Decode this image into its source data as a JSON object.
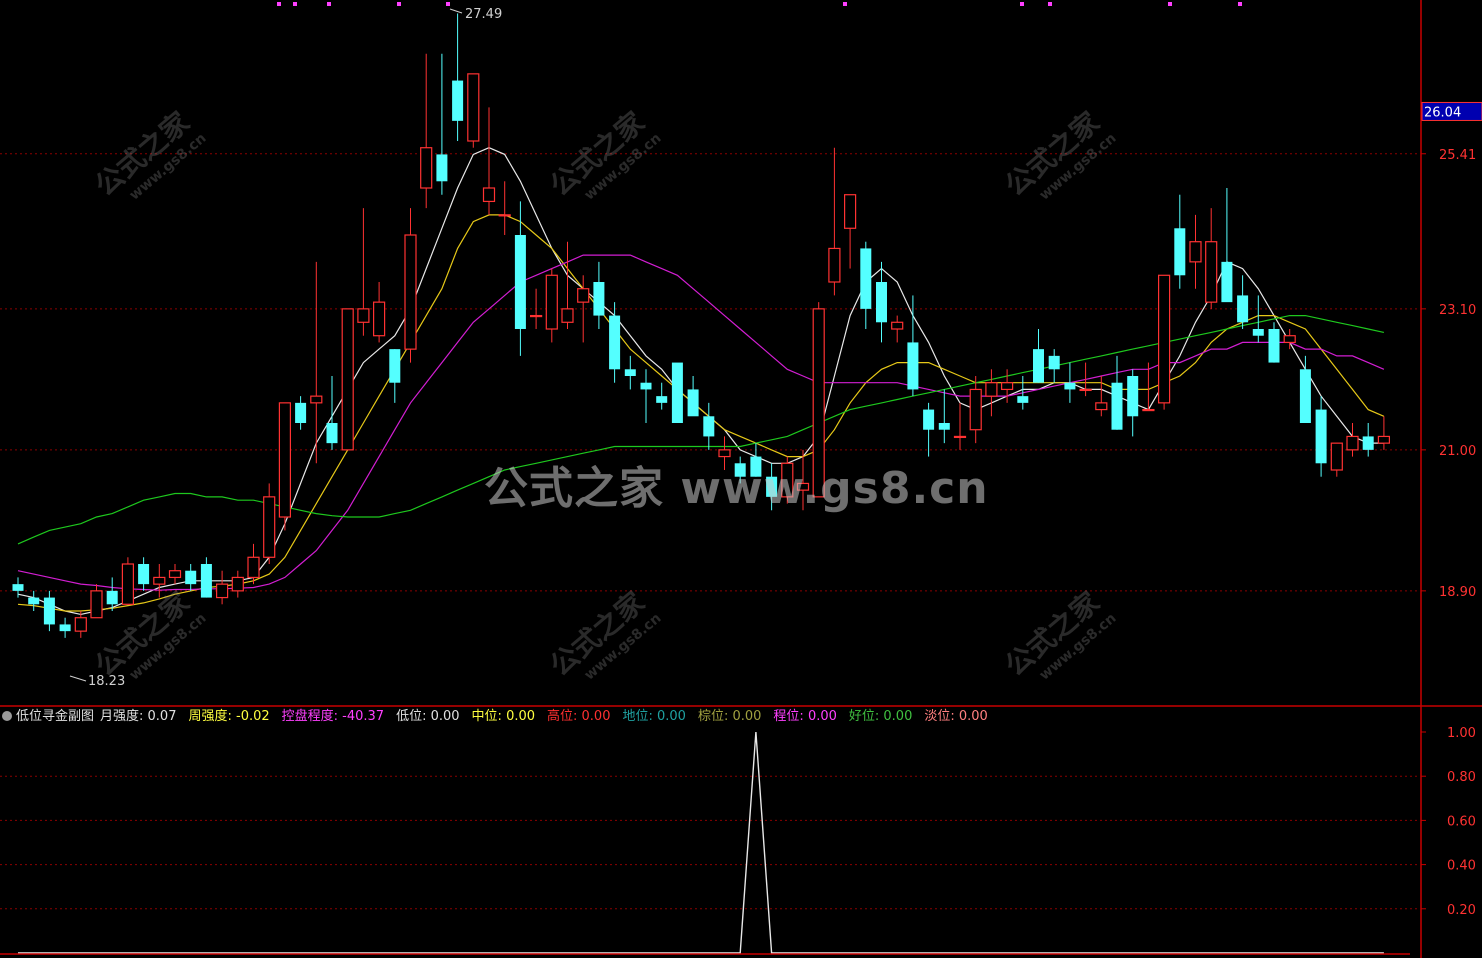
{
  "watermark": {
    "center": "公式之家 www.gs8.cn",
    "tile_main": "公式之家",
    "tile_sub": "www.gs8.cn"
  },
  "price_axis": {
    "labels": [
      "26.04",
      "25.41",
      "23.10",
      "21.00",
      "18.90"
    ],
    "current": "26.04"
  },
  "indicator_axis": {
    "labels": [
      "1.00",
      "0.80",
      "0.60",
      "0.40",
      "0.20"
    ]
  },
  "annotations": {
    "high": "27.49",
    "low": "18.23"
  },
  "indicator_header": {
    "name": "低位寻金副图",
    "items": [
      {
        "label": "月强度",
        "value": "0.07",
        "color": "#e0e0e0"
      },
      {
        "label": "周强度",
        "value": "-0.02",
        "color": "#ffff40"
      },
      {
        "label": "控盘程度",
        "value": "-40.37",
        "color": "#ff40ff"
      },
      {
        "label": "低位",
        "value": "0.00",
        "color": "#e0e0e0"
      },
      {
        "label": "中位",
        "value": "0.00",
        "color": "#ffff40"
      },
      {
        "label": "高位",
        "value": "0.00",
        "color": "#ff3030"
      },
      {
        "label": "地位",
        "value": "0.00",
        "color": "#1fa0a0"
      },
      {
        "label": "棕位",
        "value": "0.00",
        "color": "#a0a040"
      },
      {
        "label": "程位",
        "value": "0.00",
        "color": "#ff40ff"
      },
      {
        "label": "好位",
        "value": "0.00",
        "color": "#40c040"
      },
      {
        "label": "淡位",
        "value": "0.00",
        "color": "#ff8080"
      }
    ]
  },
  "colors": {
    "up": "#ff3232",
    "down": "#54ffff",
    "ma1": "#e8e8e8",
    "ma2": "#e6c818",
    "ma3": "#d21ed2",
    "ma4": "#1ec81e",
    "grid": "#8b0000",
    "axis": "#c80000"
  },
  "chart_data": [
    {
      "type": "candlestick",
      "ylim": [
        17.2,
        27.7
      ],
      "grid_levels": [
        25.41,
        23.1,
        21.0,
        18.9
      ],
      "ohlc": [
        [
          19.0,
          19.1,
          18.8,
          18.9
        ],
        [
          18.8,
          18.9,
          18.6,
          18.7
        ],
        [
          18.8,
          18.9,
          18.3,
          18.4
        ],
        [
          18.4,
          18.5,
          18.2,
          18.3
        ],
        [
          18.3,
          18.6,
          18.2,
          18.5
        ],
        [
          18.5,
          19.0,
          18.5,
          18.9
        ],
        [
          18.9,
          19.1,
          18.6,
          18.7
        ],
        [
          18.7,
          19.4,
          18.7,
          19.3
        ],
        [
          19.3,
          19.4,
          18.9,
          19.0
        ],
        [
          19.0,
          19.3,
          18.8,
          19.1
        ],
        [
          19.1,
          19.3,
          19.0,
          19.2
        ],
        [
          19.2,
          19.3,
          18.9,
          19.0
        ],
        [
          19.3,
          19.4,
          18.8,
          18.8
        ],
        [
          18.8,
          19.2,
          18.7,
          19.0
        ],
        [
          18.9,
          19.2,
          18.8,
          19.1
        ],
        [
          19.1,
          19.6,
          19.0,
          19.4
        ],
        [
          19.4,
          20.5,
          19.3,
          20.3
        ],
        [
          20.0,
          21.7,
          19.8,
          21.7
        ],
        [
          21.7,
          21.8,
          21.3,
          21.4
        ],
        [
          21.7,
          23.8,
          20.8,
          21.8
        ],
        [
          21.4,
          22.1,
          21.0,
          21.1
        ],
        [
          21.0,
          23.1,
          21.0,
          23.1
        ],
        [
          22.9,
          24.6,
          22.7,
          23.1
        ],
        [
          22.7,
          23.5,
          22.6,
          23.2
        ],
        [
          22.5,
          22.5,
          21.7,
          22.0
        ],
        [
          22.5,
          24.6,
          22.3,
          24.2
        ],
        [
          24.9,
          26.9,
          24.6,
          25.5
        ],
        [
          25.4,
          26.9,
          24.8,
          25.0
        ],
        [
          26.5,
          27.5,
          25.6,
          25.9
        ],
        [
          25.6,
          26.6,
          25.5,
          26.6
        ],
        [
          24.7,
          26.1,
          24.5,
          24.9
        ],
        [
          24.5,
          25.0,
          24.2,
          24.5
        ],
        [
          24.2,
          24.7,
          22.4,
          22.8
        ],
        [
          23.0,
          23.4,
          22.8,
          23.0
        ],
        [
          22.8,
          23.7,
          22.6,
          23.6
        ],
        [
          22.9,
          24.1,
          22.8,
          23.1
        ],
        [
          23.2,
          23.6,
          22.6,
          23.4
        ],
        [
          23.5,
          23.8,
          22.8,
          23.0
        ],
        [
          23.0,
          23.2,
          22.0,
          22.2
        ],
        [
          22.2,
          22.4,
          21.9,
          22.1
        ],
        [
          22.0,
          22.2,
          21.4,
          21.9
        ],
        [
          21.8,
          22.0,
          21.6,
          21.7
        ],
        [
          22.3,
          22.0,
          21.7,
          21.4
        ],
        [
          21.9,
          22.1,
          21.7,
          21.5
        ],
        [
          21.5,
          21.7,
          21.0,
          21.2
        ],
        [
          20.9,
          21.2,
          20.7,
          21.0
        ],
        [
          20.8,
          20.9,
          20.5,
          20.6
        ],
        [
          20.9,
          21.1,
          20.6,
          20.6
        ],
        [
          20.6,
          20.8,
          20.1,
          20.3
        ],
        [
          20.3,
          20.9,
          20.2,
          20.8
        ],
        [
          20.4,
          21.0,
          20.1,
          20.5
        ],
        [
          20.3,
          23.2,
          20.3,
          23.1
        ],
        [
          23.5,
          25.5,
          23.3,
          24.0
        ],
        [
          24.3,
          24.8,
          23.7,
          24.8
        ],
        [
          24.0,
          24.1,
          22.8,
          23.1
        ],
        [
          23.5,
          23.8,
          22.6,
          22.9
        ],
        [
          22.8,
          23.0,
          22.6,
          22.9
        ],
        [
          22.6,
          23.3,
          21.8,
          21.9
        ],
        [
          21.6,
          21.7,
          20.9,
          21.3
        ],
        [
          21.4,
          21.9,
          21.1,
          21.3
        ],
        [
          21.2,
          21.7,
          21.0,
          21.2
        ],
        [
          21.3,
          22.1,
          21.1,
          21.9
        ],
        [
          21.8,
          22.2,
          21.5,
          22.0
        ],
        [
          21.9,
          22.2,
          21.7,
          22.0
        ],
        [
          21.8,
          22.1,
          21.6,
          21.7
        ],
        [
          22.5,
          22.8,
          22.0,
          22.0
        ],
        [
          22.4,
          22.5,
          22.0,
          22.2
        ],
        [
          22.0,
          22.3,
          21.7,
          21.9
        ],
        [
          21.9,
          22.3,
          21.8,
          21.9
        ],
        [
          21.6,
          22.1,
          21.5,
          21.7
        ],
        [
          22.0,
          22.4,
          21.3,
          21.3
        ],
        [
          22.1,
          22.2,
          21.2,
          21.5
        ],
        [
          21.6,
          22.3,
          21.6,
          21.6
        ],
        [
          21.7,
          23.6,
          21.6,
          23.6
        ],
        [
          24.3,
          24.8,
          23.4,
          23.6
        ],
        [
          23.8,
          24.5,
          23.4,
          24.1
        ],
        [
          23.2,
          24.6,
          23.1,
          24.1
        ],
        [
          23.8,
          24.9,
          23.3,
          23.2
        ],
        [
          23.3,
          23.6,
          22.8,
          22.9
        ],
        [
          22.8,
          23.3,
          22.6,
          22.7
        ],
        [
          22.8,
          22.9,
          22.3,
          22.3
        ],
        [
          22.6,
          22.8,
          22.5,
          22.7
        ],
        [
          22.2,
          22.4,
          21.4,
          21.4
        ],
        [
          21.6,
          21.8,
          20.6,
          20.8
        ],
        [
          20.7,
          21.1,
          20.6,
          21.1
        ],
        [
          21.0,
          21.4,
          20.9,
          21.2
        ],
        [
          21.2,
          21.4,
          20.9,
          21.0
        ],
        [
          21.1,
          21.5,
          21.0,
          21.2
        ]
      ],
      "ma_series": [
        {
          "values": [
            18.85,
            18.8,
            18.7,
            18.6,
            18.55,
            18.6,
            18.65,
            18.75,
            18.85,
            18.95,
            19.0,
            19.05,
            19.05,
            19.05,
            19.05,
            19.1,
            19.4,
            19.9,
            20.5,
            21.1,
            21.5,
            21.9,
            22.3,
            22.5,
            22.7,
            23.1,
            23.7,
            24.3,
            24.9,
            25.4,
            25.5,
            25.4,
            25.0,
            24.5,
            24.0,
            23.6,
            23.4,
            23.2,
            23.0,
            22.7,
            22.4,
            22.2,
            21.9,
            21.7,
            21.5,
            21.3,
            21.0,
            20.9,
            20.8,
            20.8,
            20.9,
            21.2,
            22.1,
            23.0,
            23.5,
            23.7,
            23.5,
            23.0,
            22.6,
            22.1,
            21.7,
            21.6,
            21.7,
            21.8,
            21.9,
            21.9,
            22.0,
            22.0,
            21.9,
            21.9,
            21.8,
            21.7,
            21.6,
            22.0,
            22.4,
            22.9,
            23.3,
            23.8,
            23.7,
            23.4,
            23.0,
            22.6,
            22.2,
            21.8,
            21.5,
            21.2,
            21.1,
            21.1
          ]
        },
        {
          "values": [
            18.7,
            18.68,
            18.64,
            18.6,
            18.6,
            18.62,
            18.64,
            18.68,
            18.72,
            18.78,
            18.85,
            18.9,
            18.95,
            18.97,
            19.0,
            19.05,
            19.15,
            19.4,
            19.8,
            20.2,
            20.6,
            21.0,
            21.4,
            21.8,
            22.2,
            22.6,
            23.0,
            23.4,
            24.0,
            24.4,
            24.5,
            24.5,
            24.4,
            24.2,
            24.0,
            23.7,
            23.4,
            23.1,
            22.8,
            22.5,
            22.3,
            22.1,
            21.9,
            21.7,
            21.5,
            21.3,
            21.2,
            21.1,
            21.0,
            20.9,
            20.9,
            21.0,
            21.3,
            21.7,
            22.0,
            22.2,
            22.3,
            22.3,
            22.3,
            22.2,
            22.1,
            22.0,
            22.0,
            22.0,
            22.0,
            22.0,
            22.0,
            22.0,
            22.0,
            22.0,
            21.9,
            21.9,
            21.9,
            22.0,
            22.1,
            22.3,
            22.6,
            22.8,
            22.9,
            23.0,
            23.0,
            22.9,
            22.8,
            22.5,
            22.2,
            21.9,
            21.6,
            21.5
          ]
        },
        {
          "values": [
            19.2,
            19.15,
            19.1,
            19.05,
            19.0,
            18.98,
            18.95,
            18.93,
            18.92,
            18.91,
            18.92,
            18.92,
            18.93,
            18.93,
            18.94,
            18.95,
            19.0,
            19.1,
            19.3,
            19.5,
            19.8,
            20.1,
            20.5,
            20.9,
            21.3,
            21.7,
            22.0,
            22.3,
            22.6,
            22.9,
            23.1,
            23.3,
            23.5,
            23.6,
            23.7,
            23.8,
            23.9,
            23.9,
            23.9,
            23.9,
            23.8,
            23.7,
            23.6,
            23.4,
            23.2,
            23.0,
            22.8,
            22.6,
            22.4,
            22.2,
            22.1,
            22.0,
            22.0,
            22.0,
            22.0,
            22.0,
            22.0,
            21.95,
            21.9,
            21.85,
            21.8,
            21.8,
            21.8,
            21.8,
            21.85,
            21.9,
            21.95,
            22.0,
            22.05,
            22.1,
            22.15,
            22.2,
            22.2,
            22.3,
            22.3,
            22.4,
            22.5,
            22.5,
            22.6,
            22.6,
            22.6,
            22.6,
            22.5,
            22.5,
            22.4,
            22.4,
            22.3,
            22.2
          ]
        },
        {
          "values": [
            19.6,
            19.7,
            19.8,
            19.85,
            19.9,
            20.0,
            20.05,
            20.15,
            20.25,
            20.3,
            20.35,
            20.35,
            20.3,
            20.3,
            20.25,
            20.25,
            20.2,
            20.15,
            20.1,
            20.05,
            20.02,
            20.0,
            20.0,
            20.0,
            20.05,
            20.1,
            20.2,
            20.3,
            20.4,
            20.5,
            20.6,
            20.7,
            20.75,
            20.8,
            20.85,
            20.9,
            20.95,
            21.0,
            21.05,
            21.05,
            21.05,
            21.05,
            21.05,
            21.05,
            21.05,
            21.05,
            21.05,
            21.1,
            21.15,
            21.2,
            21.3,
            21.4,
            21.5,
            21.6,
            21.65,
            21.7,
            21.75,
            21.8,
            21.85,
            21.9,
            21.95,
            22.0,
            22.05,
            22.1,
            22.15,
            22.2,
            22.25,
            22.3,
            22.35,
            22.4,
            22.45,
            22.5,
            22.55,
            22.6,
            22.65,
            22.7,
            22.75,
            22.8,
            22.85,
            22.9,
            22.95,
            23.0,
            23.0,
            22.95,
            22.9,
            22.85,
            22.8,
            22.75
          ]
        }
      ]
    },
    {
      "type": "line",
      "ylim": [
        0,
        1.0
      ],
      "grid_levels": [
        1.0,
        0.8,
        0.6,
        0.4,
        0.2
      ],
      "series": [
        {
          "values": [
            0,
            0,
            0,
            0,
            0,
            0,
            0,
            0,
            0,
            0,
            0,
            0,
            0,
            0,
            0,
            0,
            0,
            0,
            0,
            0,
            0,
            0,
            0,
            0,
            0,
            0,
            0,
            0,
            0,
            0,
            0,
            0,
            0,
            0,
            0,
            0,
            0,
            0,
            0,
            0,
            0,
            0,
            0,
            0,
            0,
            0,
            0,
            1,
            0,
            0,
            0,
            0,
            0,
            0,
            0,
            0,
            0,
            0,
            0,
            0,
            0,
            0,
            0,
            0,
            0,
            0,
            0,
            0,
            0,
            0,
            0,
            0,
            0,
            0,
            0,
            0,
            0,
            0,
            0,
            0,
            0,
            0,
            0,
            0,
            0,
            0,
            0,
            0
          ]
        }
      ]
    }
  ]
}
